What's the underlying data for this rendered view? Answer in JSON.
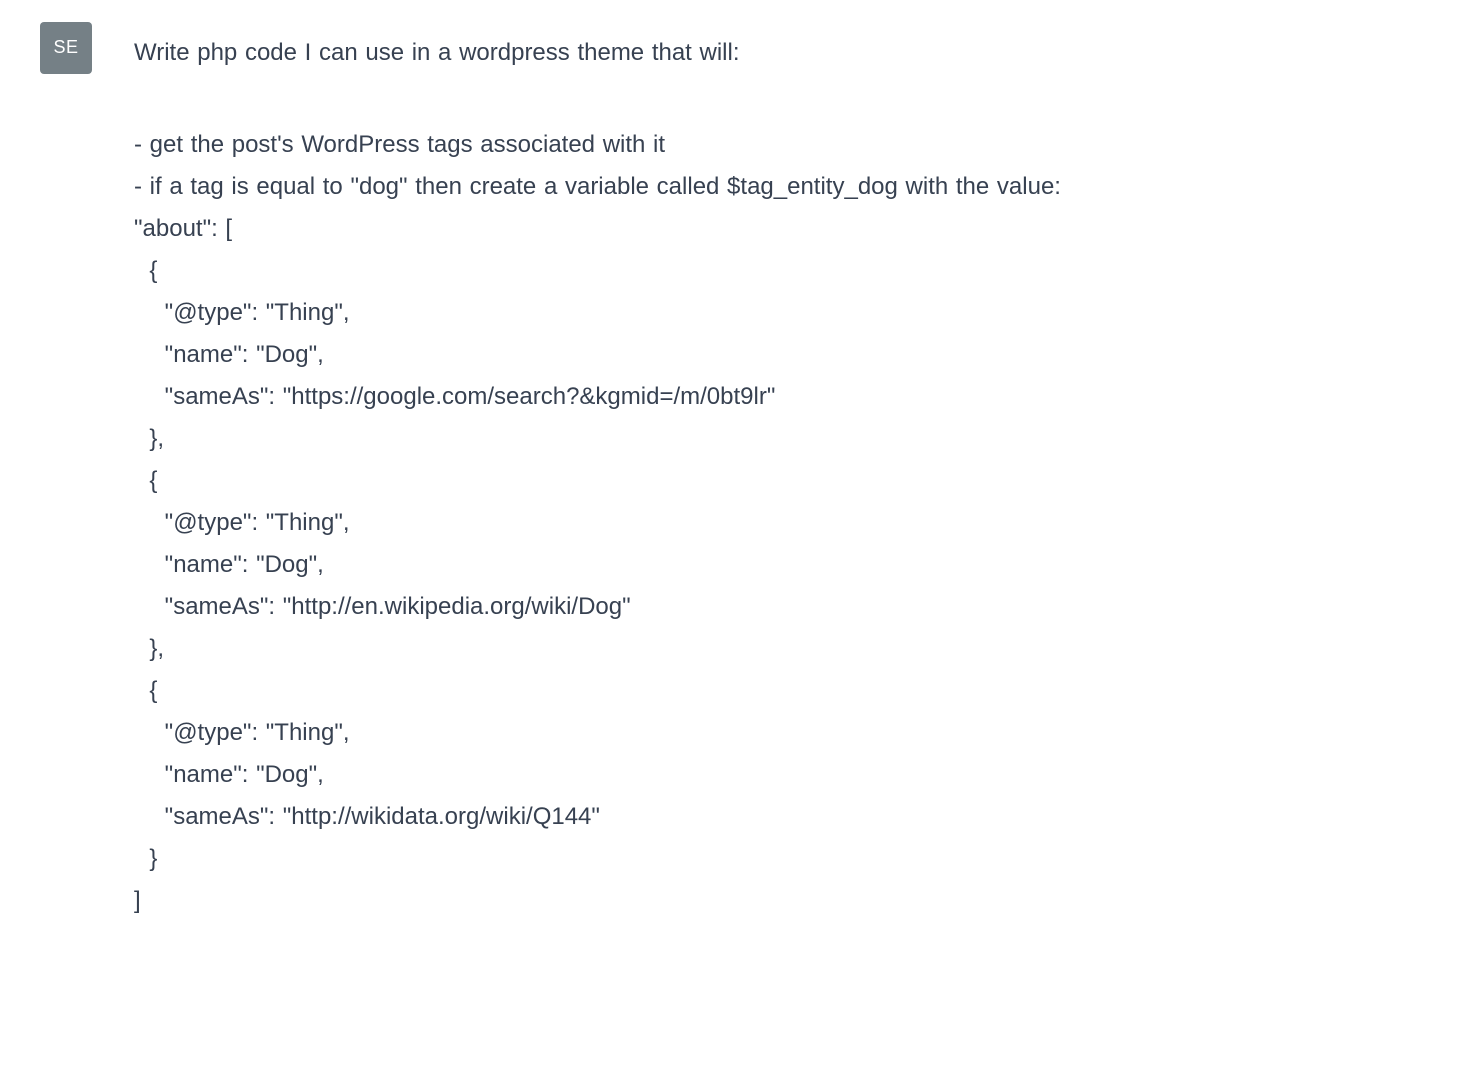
{
  "avatar": {
    "initials": "SE"
  },
  "message": {
    "intro": "Write php code I can use in a wordpress theme that will:",
    "lines": [
      "- get the post's WordPress tags associated with it",
      "- if a tag is equal to \"dog\" then create a variable called $tag_entity_dog with the value:",
      "\"about\": [",
      "  {",
      "    \"@type\": \"Thing\",",
      "    \"name\": \"Dog\",",
      "    \"sameAs\": \"https://google.com/search?&kgmid=/m/0bt9lr\"",
      "  },",
      "  {",
      "    \"@type\": \"Thing\",",
      "    \"name\": \"Dog\",",
      "    \"sameAs\": \"http://en.wikipedia.org/wiki/Dog\"",
      "  },",
      "  {",
      "    \"@type\": \"Thing\",",
      "    \"name\": \"Dog\",",
      "    \"sameAs\": \"http://wikidata.org/wiki/Q144\"",
      "  }",
      "]"
    ]
  }
}
